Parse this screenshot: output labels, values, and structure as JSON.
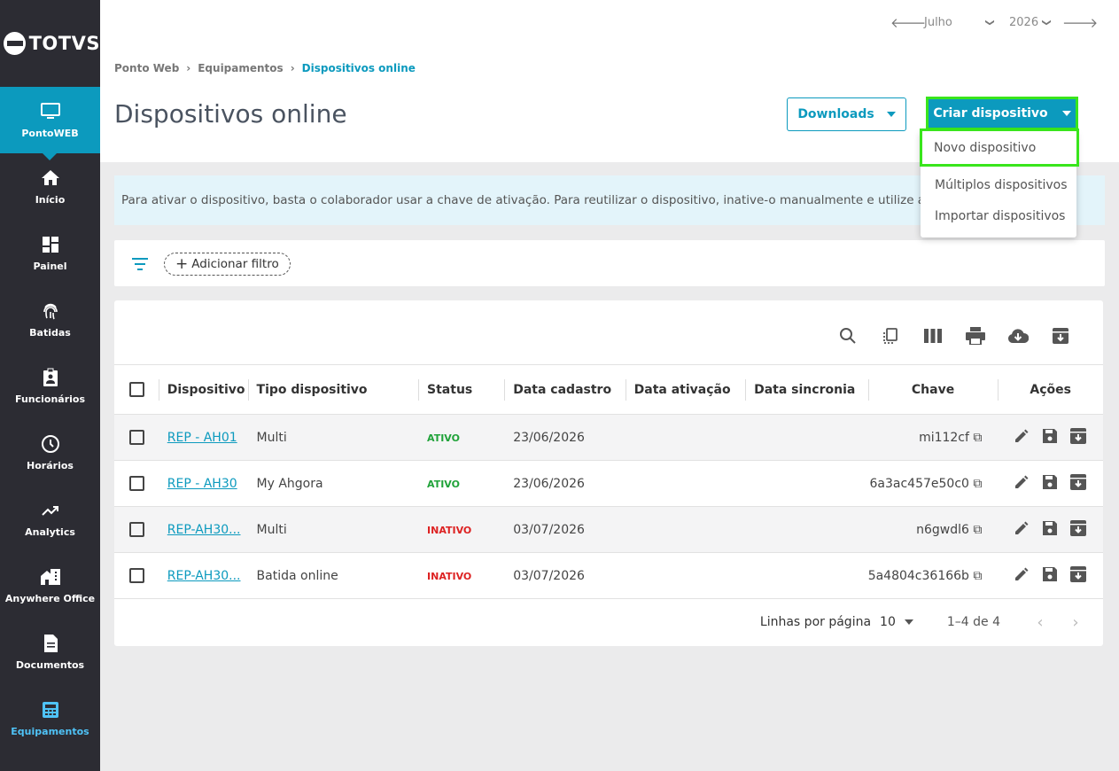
{
  "brand": {
    "logo_text": "TOTVS"
  },
  "sidebar": {
    "items": [
      {
        "label": "PontoWEB",
        "icon": "monitor-icon"
      },
      {
        "label": "Início",
        "icon": "home-icon"
      },
      {
        "label": "Painel",
        "icon": "dashboard-icon"
      },
      {
        "label": "Batidas",
        "icon": "fingerprint-icon"
      },
      {
        "label": "Funcionários",
        "icon": "badge-icon"
      },
      {
        "label": "Horários",
        "icon": "clock-icon"
      },
      {
        "label": "Analytics",
        "icon": "trending-up-icon"
      },
      {
        "label": "Anywhere Office",
        "icon": "home-work-icon"
      },
      {
        "label": "Documentos",
        "icon": "document-icon"
      },
      {
        "label": "Equipamentos",
        "icon": "calculator-icon"
      }
    ]
  },
  "period": {
    "month": "Julho",
    "year": "2026"
  },
  "breadcrumb": {
    "root": "Ponto Web",
    "section": "Equipamentos",
    "current": "Dispositivos online",
    "separator": "›"
  },
  "page": {
    "title": "Dispositivos online"
  },
  "actions": {
    "downloads_label": "Downloads",
    "create_label": "Criar dispositivo"
  },
  "create_menu": {
    "items": [
      "Novo dispositivo",
      "Múltiplos dispositivos",
      "Importar dispositivos"
    ]
  },
  "info_banner": "Para ativar o dispositivo, basta o colaborador usar a chave de ativação. Para reutilizar o dispositivo, inative-o manualmente e utilize a m",
  "filter": {
    "add_label": "Adicionar filtro"
  },
  "table": {
    "headers": {
      "device": "Dispositivo",
      "type": "Tipo dispositivo",
      "status": "Status",
      "created": "Data cadastro",
      "activated": "Data ativação",
      "synced": "Data sincronia",
      "key": "Chave",
      "actions": "Ações"
    },
    "rows": [
      {
        "device": "REP - AH01",
        "type": "Multi",
        "status": "ATIVO",
        "created": "23/06/2026",
        "activated": "",
        "synced": "",
        "key": "mi112cf"
      },
      {
        "device": "REP - AH30",
        "type": "My Ahgora",
        "status": "ATIVO",
        "created": "23/06/2026",
        "activated": "",
        "synced": "",
        "key": "6a3ac457e50c0"
      },
      {
        "device": "REP-AH30...",
        "type": "Multi",
        "status": "INATIVO",
        "created": "03/07/2026",
        "activated": "",
        "synced": "",
        "key": "n6gwdl6"
      },
      {
        "device": "REP-AH30...",
        "type": "Batida online",
        "status": "INATIVO",
        "created": "03/07/2026",
        "activated": "",
        "synced": "",
        "key": "5a4804c36166b"
      }
    ]
  },
  "pagination": {
    "rows_per_page_label": "Linhas por página",
    "rows_per_page": "10",
    "range": "1–4 de 4"
  },
  "colors": {
    "accent": "#0c9abe",
    "sidebar": "#2c2c33",
    "active_status": "#21a33a",
    "inactive_status": "#dd2222",
    "highlight": "#39e51c"
  }
}
